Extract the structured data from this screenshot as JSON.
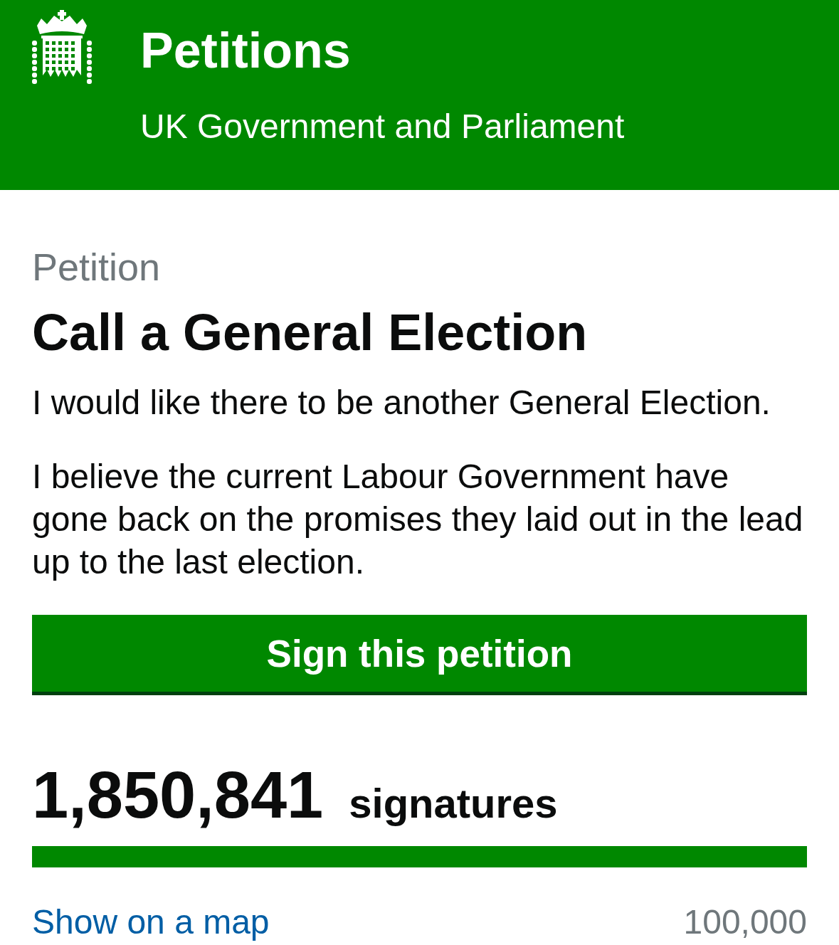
{
  "header": {
    "title": "Petitions",
    "subtitle": "UK Government and Parliament"
  },
  "petition": {
    "label": "Petition",
    "title": "Call a General Election",
    "summary": "I would like there to be another General Election.",
    "details": "I believe the current Labour Government have gone back on the promises they laid out in the lead up to the last election."
  },
  "sign_button": "Sign this petition",
  "signatures": {
    "count": "1,850,841",
    "unit": "signatures",
    "level": 1
  },
  "map_link": "Show on a map",
  "threshold": "100,000"
}
